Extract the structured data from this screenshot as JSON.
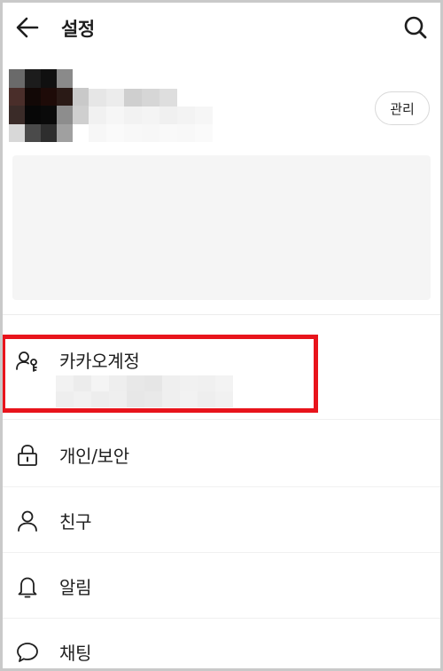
{
  "header": {
    "title": "설정"
  },
  "profile": {
    "manage_label": "관리"
  },
  "menu": {
    "items": [
      {
        "label": "카카오계정",
        "icon": "person-key-icon"
      },
      {
        "label": "개인/보안",
        "icon": "lock-icon"
      },
      {
        "label": "친구",
        "icon": "person-icon"
      },
      {
        "label": "알림",
        "icon": "bell-icon"
      },
      {
        "label": "채팅",
        "icon": "chat-bubble-icon"
      }
    ]
  },
  "colors": {
    "highlight": "#e8141c",
    "banner": "#f5f5f5"
  }
}
